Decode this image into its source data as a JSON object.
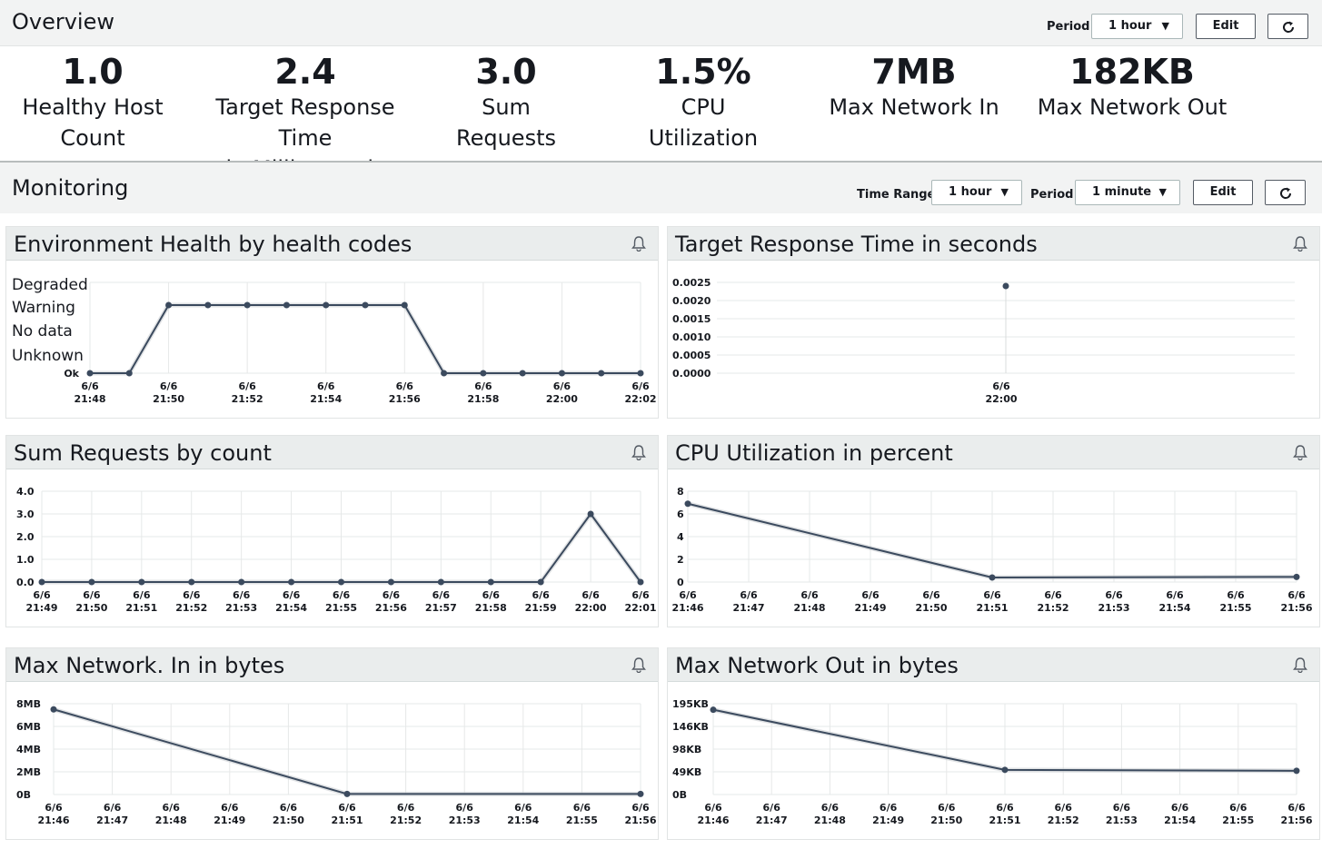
{
  "overview": {
    "title": "Overview",
    "period_label": "Period",
    "period_value": "1 hour",
    "edit_label": "Edit",
    "metrics": [
      {
        "value": "1.0",
        "label1": "Healthy Host",
        "label2": "Count"
      },
      {
        "value": "2.4",
        "label1": "Target Response Time",
        "label2": "in Milliseconds"
      },
      {
        "value": "3.0",
        "label1": "Sum",
        "label2": "Requests"
      },
      {
        "value": "1.5%",
        "label1": "CPU",
        "label2": "Utilization"
      },
      {
        "value": "7MB",
        "label1": "Max Network In",
        "label2": ""
      },
      {
        "value": "182KB",
        "label1": "Max Network Out",
        "label2": ""
      }
    ]
  },
  "monitoring": {
    "title": "Monitoring",
    "time_range_label": "Time Range",
    "time_range_value": "1 hour",
    "period_label": "Period",
    "period_value": "1 minute",
    "edit_label": "Edit"
  },
  "colors": {
    "line": "#3b4a5e",
    "grid": "#e6e8e8",
    "panel_head": "#eaeded"
  },
  "chart_data": [
    {
      "type": "line",
      "title": "Environment Health by health codes",
      "y_categories": [
        "Ok",
        "Unknown",
        "No data",
        "Warning",
        "Degraded"
      ],
      "x_ticks": [
        "6/6 21:48",
        "6/6 21:50",
        "6/6 21:52",
        "6/6 21:54",
        "6/6 21:56",
        "6/6 21:58",
        "6/6 22:00",
        "6/6 22:02"
      ],
      "x": [
        "21:48",
        "21:49",
        "21:50",
        "21:51",
        "21:52",
        "21:53",
        "21:54",
        "21:55",
        "21:56",
        "21:57",
        "21:58",
        "21:59",
        "22:00",
        "22:01",
        "22:02"
      ],
      "values": [
        "Ok",
        "Ok",
        "Warning",
        "Warning",
        "Warning",
        "Warning",
        "Warning",
        "Warning",
        "Warning",
        "Ok",
        "Ok",
        "Ok",
        "Ok",
        "Ok",
        "Ok"
      ]
    },
    {
      "type": "scatter",
      "title": "Target Response Time in seconds",
      "y_ticks": [
        "0.0025",
        "0.0020",
        "0.0015",
        "0.0010",
        "0.0005",
        "0.0000"
      ],
      "ylim": [
        0,
        0.0025
      ],
      "x_ticks": [
        "6/6 22:00"
      ],
      "x": [
        "22:00"
      ],
      "values": [
        0.0024
      ]
    },
    {
      "type": "line",
      "title": "Sum Requests by count",
      "y_ticks": [
        "4.0",
        "3.0",
        "2.0",
        "1.0",
        "0.0"
      ],
      "ylim": [
        0,
        4
      ],
      "x_ticks": [
        "6/6 21:49",
        "6/6 21:50",
        "6/6 21:51",
        "6/6 21:52",
        "6/6 21:53",
        "6/6 21:54",
        "6/6 21:55",
        "6/6 21:56",
        "6/6 21:57",
        "6/6 21:58",
        "6/6 21:59",
        "6/6 22:00",
        "6/6 22:01"
      ],
      "x": [
        "21:49",
        "21:50",
        "21:51",
        "21:52",
        "21:53",
        "21:54",
        "21:55",
        "21:56",
        "21:57",
        "21:58",
        "21:59",
        "22:00",
        "22:01"
      ],
      "values": [
        0,
        0,
        0,
        0,
        0,
        0,
        0,
        0,
        0,
        0,
        0,
        3,
        0
      ]
    },
    {
      "type": "line",
      "title": "CPU Utilization in percent",
      "y_ticks": [
        "8",
        "6",
        "4",
        "2",
        "0"
      ],
      "ylim": [
        0,
        8
      ],
      "x_ticks": [
        "6/6 21:46",
        "6/6 21:47",
        "6/6 21:48",
        "6/6 21:49",
        "6/6 21:50",
        "6/6 21:51",
        "6/6 21:52",
        "6/6 21:53",
        "6/6 21:54",
        "6/6 21:55",
        "6/6 21:56"
      ],
      "x": [
        "21:46",
        "21:51",
        "21:56"
      ],
      "values": [
        6.9,
        0.4,
        0.45
      ]
    },
    {
      "type": "line",
      "title": "Max Network. In in bytes",
      "y_ticks": [
        "8MB",
        "6MB",
        "4MB",
        "2MB",
        "0B"
      ],
      "ylim": [
        0,
        8
      ],
      "x_ticks": [
        "6/6 21:46",
        "6/6 21:47",
        "6/6 21:48",
        "6/6 21:49",
        "6/6 21:50",
        "6/6 21:51",
        "6/6 21:52",
        "6/6 21:53",
        "6/6 21:54",
        "6/6 21:55",
        "6/6 21:56"
      ],
      "x": [
        "21:46",
        "21:51",
        "21:56"
      ],
      "values": [
        7.5,
        0.05,
        0.05
      ]
    },
    {
      "type": "line",
      "title": "Max Network Out in bytes",
      "y_ticks": [
        "195KB",
        "146KB",
        "98KB",
        "49KB",
        "0B"
      ],
      "ylim": [
        0,
        195
      ],
      "x_ticks": [
        "6/6 21:46",
        "6/6 21:47",
        "6/6 21:48",
        "6/6 21:49",
        "6/6 21:50",
        "6/6 21:51",
        "6/6 21:52",
        "6/6 21:53",
        "6/6 21:54",
        "6/6 21:55",
        "6/6 21:56"
      ],
      "x": [
        "21:46",
        "21:51",
        "21:56"
      ],
      "values": [
        182,
        53,
        51
      ]
    }
  ]
}
